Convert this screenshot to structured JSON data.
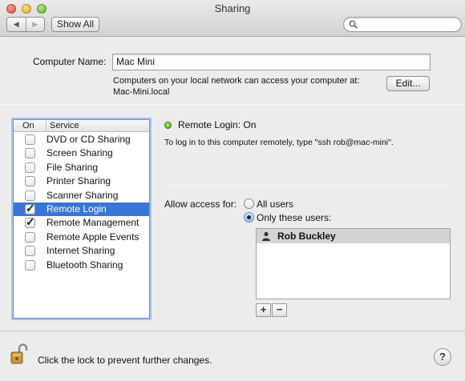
{
  "window": {
    "title": "Sharing"
  },
  "toolbar": {
    "back_glyph": "◀",
    "forward_glyph": "▶",
    "show_all_label": "Show All",
    "search_value": ""
  },
  "computer_name": {
    "label": "Computer Name:",
    "value": "Mac Mini",
    "description_line1": "Computers on your local network can access your computer at:",
    "description_line2": "Mac-Mini.local",
    "edit_label": "Edit..."
  },
  "services": {
    "header_on": "On",
    "header_service": "Service",
    "items": [
      {
        "label": "DVD or CD Sharing",
        "checked": false,
        "selected": false
      },
      {
        "label": "Screen Sharing",
        "checked": false,
        "selected": false
      },
      {
        "label": "File Sharing",
        "checked": false,
        "selected": false
      },
      {
        "label": "Printer Sharing",
        "checked": false,
        "selected": false
      },
      {
        "label": "Scanner Sharing",
        "checked": false,
        "selected": false
      },
      {
        "label": "Remote Login",
        "checked": true,
        "selected": true
      },
      {
        "label": "Remote Management",
        "checked": true,
        "selected": false
      },
      {
        "label": "Remote Apple Events",
        "checked": false,
        "selected": false
      },
      {
        "label": "Internet Sharing",
        "checked": false,
        "selected": false
      },
      {
        "label": "Bluetooth Sharing",
        "checked": false,
        "selected": false
      }
    ]
  },
  "detail": {
    "status_text": "Remote Login: On",
    "status_color": "#3ca21b",
    "instructions": "To log in to this computer remotely, type \"ssh rob@mac-mini\".",
    "access_label": "Allow access for:",
    "option_all": "All users",
    "option_only": "Only these users:",
    "selected_option": "only",
    "users": [
      "Rob Buckley"
    ],
    "add_label": "+",
    "remove_label": "−"
  },
  "footer": {
    "lock_text": "Click the lock to prevent further changes.",
    "help_label": "?"
  },
  "colors": {
    "selection": "#3875d7",
    "focus_ring": "#a8c2ec"
  }
}
